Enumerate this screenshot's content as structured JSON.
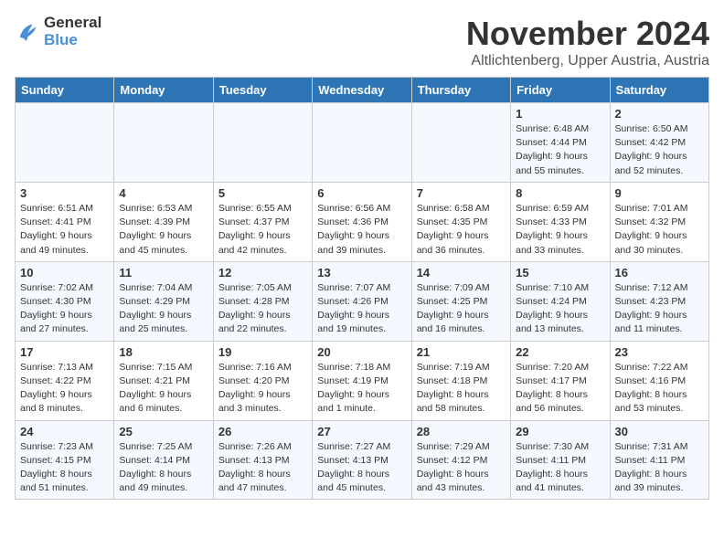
{
  "logo": {
    "line1": "General",
    "line2": "Blue"
  },
  "title": "November 2024",
  "location": "Altlichtenberg, Upper Austria, Austria",
  "days_of_week": [
    "Sunday",
    "Monday",
    "Tuesday",
    "Wednesday",
    "Thursday",
    "Friday",
    "Saturday"
  ],
  "weeks": [
    [
      {
        "day": "",
        "info": ""
      },
      {
        "day": "",
        "info": ""
      },
      {
        "day": "",
        "info": ""
      },
      {
        "day": "",
        "info": ""
      },
      {
        "day": "",
        "info": ""
      },
      {
        "day": "1",
        "info": "Sunrise: 6:48 AM\nSunset: 4:44 PM\nDaylight: 9 hours and 55 minutes."
      },
      {
        "day": "2",
        "info": "Sunrise: 6:50 AM\nSunset: 4:42 PM\nDaylight: 9 hours and 52 minutes."
      }
    ],
    [
      {
        "day": "3",
        "info": "Sunrise: 6:51 AM\nSunset: 4:41 PM\nDaylight: 9 hours and 49 minutes."
      },
      {
        "day": "4",
        "info": "Sunrise: 6:53 AM\nSunset: 4:39 PM\nDaylight: 9 hours and 45 minutes."
      },
      {
        "day": "5",
        "info": "Sunrise: 6:55 AM\nSunset: 4:37 PM\nDaylight: 9 hours and 42 minutes."
      },
      {
        "day": "6",
        "info": "Sunrise: 6:56 AM\nSunset: 4:36 PM\nDaylight: 9 hours and 39 minutes."
      },
      {
        "day": "7",
        "info": "Sunrise: 6:58 AM\nSunset: 4:35 PM\nDaylight: 9 hours and 36 minutes."
      },
      {
        "day": "8",
        "info": "Sunrise: 6:59 AM\nSunset: 4:33 PM\nDaylight: 9 hours and 33 minutes."
      },
      {
        "day": "9",
        "info": "Sunrise: 7:01 AM\nSunset: 4:32 PM\nDaylight: 9 hours and 30 minutes."
      }
    ],
    [
      {
        "day": "10",
        "info": "Sunrise: 7:02 AM\nSunset: 4:30 PM\nDaylight: 9 hours and 27 minutes."
      },
      {
        "day": "11",
        "info": "Sunrise: 7:04 AM\nSunset: 4:29 PM\nDaylight: 9 hours and 25 minutes."
      },
      {
        "day": "12",
        "info": "Sunrise: 7:05 AM\nSunset: 4:28 PM\nDaylight: 9 hours and 22 minutes."
      },
      {
        "day": "13",
        "info": "Sunrise: 7:07 AM\nSunset: 4:26 PM\nDaylight: 9 hours and 19 minutes."
      },
      {
        "day": "14",
        "info": "Sunrise: 7:09 AM\nSunset: 4:25 PM\nDaylight: 9 hours and 16 minutes."
      },
      {
        "day": "15",
        "info": "Sunrise: 7:10 AM\nSunset: 4:24 PM\nDaylight: 9 hours and 13 minutes."
      },
      {
        "day": "16",
        "info": "Sunrise: 7:12 AM\nSunset: 4:23 PM\nDaylight: 9 hours and 11 minutes."
      }
    ],
    [
      {
        "day": "17",
        "info": "Sunrise: 7:13 AM\nSunset: 4:22 PM\nDaylight: 9 hours and 8 minutes."
      },
      {
        "day": "18",
        "info": "Sunrise: 7:15 AM\nSunset: 4:21 PM\nDaylight: 9 hours and 6 minutes."
      },
      {
        "day": "19",
        "info": "Sunrise: 7:16 AM\nSunset: 4:20 PM\nDaylight: 9 hours and 3 minutes."
      },
      {
        "day": "20",
        "info": "Sunrise: 7:18 AM\nSunset: 4:19 PM\nDaylight: 9 hours and 1 minute."
      },
      {
        "day": "21",
        "info": "Sunrise: 7:19 AM\nSunset: 4:18 PM\nDaylight: 8 hours and 58 minutes."
      },
      {
        "day": "22",
        "info": "Sunrise: 7:20 AM\nSunset: 4:17 PM\nDaylight: 8 hours and 56 minutes."
      },
      {
        "day": "23",
        "info": "Sunrise: 7:22 AM\nSunset: 4:16 PM\nDaylight: 8 hours and 53 minutes."
      }
    ],
    [
      {
        "day": "24",
        "info": "Sunrise: 7:23 AM\nSunset: 4:15 PM\nDaylight: 8 hours and 51 minutes."
      },
      {
        "day": "25",
        "info": "Sunrise: 7:25 AM\nSunset: 4:14 PM\nDaylight: 8 hours and 49 minutes."
      },
      {
        "day": "26",
        "info": "Sunrise: 7:26 AM\nSunset: 4:13 PM\nDaylight: 8 hours and 47 minutes."
      },
      {
        "day": "27",
        "info": "Sunrise: 7:27 AM\nSunset: 4:13 PM\nDaylight: 8 hours and 45 minutes."
      },
      {
        "day": "28",
        "info": "Sunrise: 7:29 AM\nSunset: 4:12 PM\nDaylight: 8 hours and 43 minutes."
      },
      {
        "day": "29",
        "info": "Sunrise: 7:30 AM\nSunset: 4:11 PM\nDaylight: 8 hours and 41 minutes."
      },
      {
        "day": "30",
        "info": "Sunrise: 7:31 AM\nSunset: 4:11 PM\nDaylight: 8 hours and 39 minutes."
      }
    ]
  ]
}
